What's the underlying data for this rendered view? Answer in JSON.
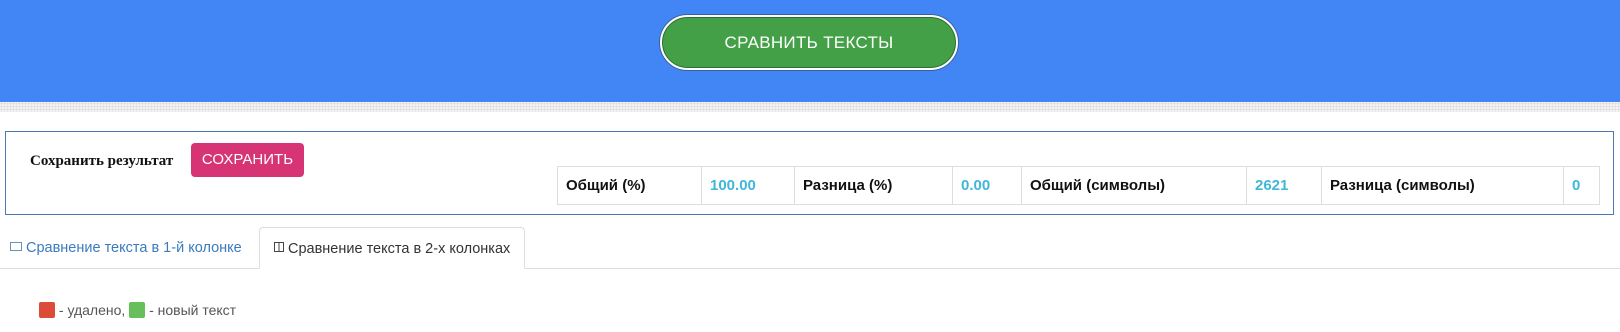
{
  "header": {
    "compare_button": "СРАВНИТЬ ТЕКСТЫ"
  },
  "result_panel": {
    "save_label": "Сохранить результат",
    "save_button": "СОХРАНИТЬ",
    "stats": [
      {
        "label": "Общий (%)",
        "value": "100.00"
      },
      {
        "label": "Разница (%)",
        "value": "0.00"
      },
      {
        "label": "Общий (символы)",
        "value": "2621"
      },
      {
        "label": "Разница (символы)",
        "value": "0"
      }
    ]
  },
  "tabs": [
    {
      "label": "Сравнение текста в 1-й колонке",
      "icon": "single-column-icon",
      "active": false
    },
    {
      "label": "Сравнение текста в 2-х колонках",
      "icon": "two-columns-icon",
      "active": true
    }
  ],
  "legend": {
    "deleted_text": "- удалено,",
    "new_text": "- новый текст",
    "deleted_color": "#dd4b39",
    "new_color": "#67bf5c"
  },
  "colors": {
    "header_bg": "#4285f4",
    "compare_button_bg": "#43a047",
    "save_button_bg": "#d63474",
    "stat_value": "#3fb7d9",
    "link": "#3a7bbf"
  }
}
